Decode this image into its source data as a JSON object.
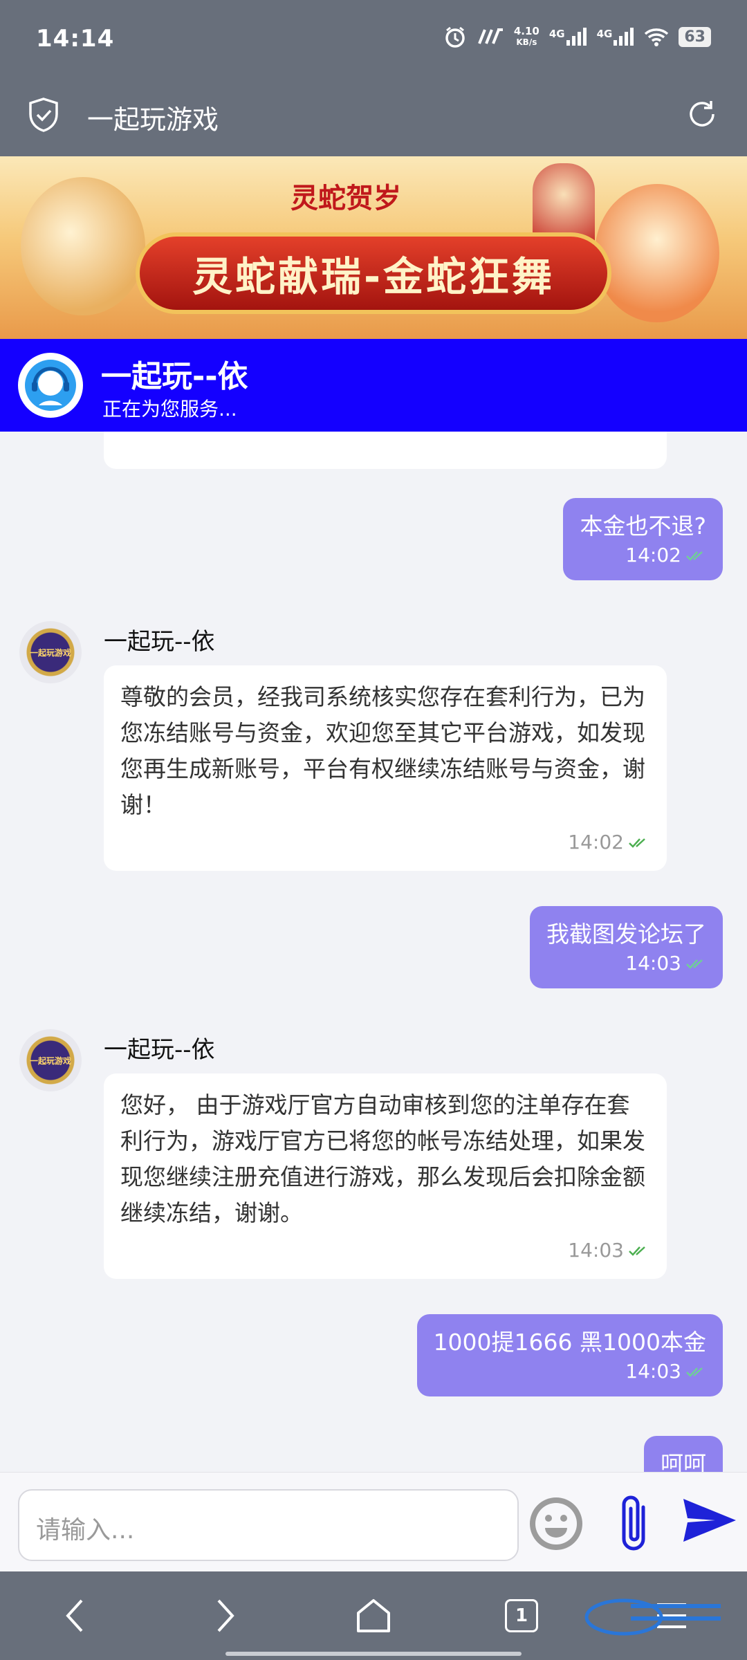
{
  "status_bar": {
    "time": "14:14",
    "net_speed_value": "4.10",
    "net_speed_unit": "KB/s",
    "sim1": "4G",
    "sim2": "4G",
    "battery": "63"
  },
  "title_bar": {
    "title": "一起玩游戏"
  },
  "banner": {
    "small_title": "灵蛇贺岁",
    "main_title": "灵蛇献瑞-金蛇狂舞"
  },
  "agent": {
    "name": "一起玩--依",
    "status": "正在为您服务..."
  },
  "messages": [
    {
      "side": "out",
      "text": "本金也不退?",
      "time": "14:02"
    },
    {
      "side": "in",
      "sender": "一起玩--依",
      "avatar_text": "一起玩游戏",
      "text": "尊敬的会员，经我司系统核实您存在套利行为，已为您冻结账号与资金，欢迎您至其它平台游戏，如发现您再生成新账号，平台有权继续冻结账号与资金，谢谢！",
      "time": "14:02"
    },
    {
      "side": "out",
      "text": "我截图发论坛了",
      "time": "14:03"
    },
    {
      "side": "in",
      "sender": "一起玩--依",
      "avatar_text": "一起玩游戏",
      "text": "您好， 由于游戏厅官方自动审核到您的注单存在套利行为，游戏厅官方已将您的帐号冻结处理，如果发现您继续注册充值进行游戏，那么发现后会扣除金额继续冻结，谢谢。",
      "time": "14:03"
    },
    {
      "side": "out",
      "text": "1000提1666 黑1000本金",
      "time": "14:03"
    },
    {
      "side": "out",
      "text": "呵呵",
      "time": ""
    }
  ],
  "input": {
    "placeholder": "请输入..."
  },
  "nav": {
    "tab_count": "1"
  },
  "colors": {
    "status_bar": "#686f7b",
    "agent_bar": "#1400ff",
    "outgoing_bubble": "#8f82ef",
    "send_icon": "#1e22d8"
  }
}
